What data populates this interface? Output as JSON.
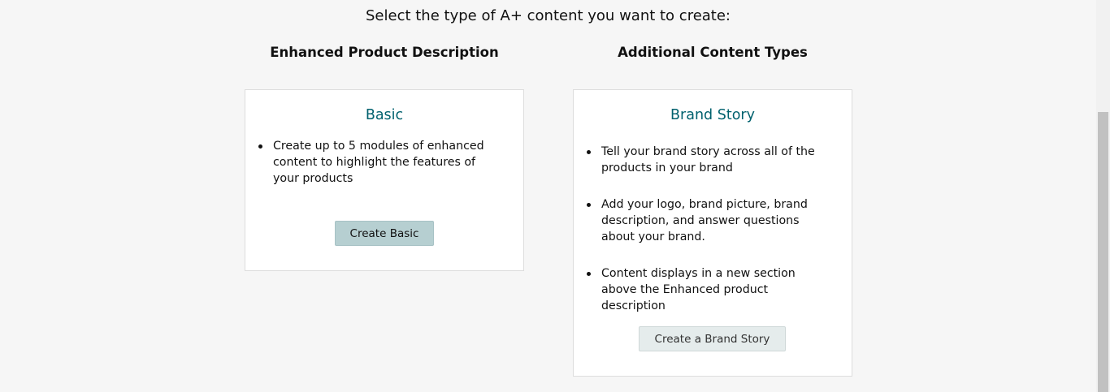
{
  "page": {
    "heading": "Select the type of A+ content you want to create:"
  },
  "columns": {
    "left_title": "Enhanced Product Description",
    "right_title": "Additional Content Types"
  },
  "basic_card": {
    "title": "Basic",
    "bullets": [
      "Create up to 5 modules of enhanced content to highlight the features of your products"
    ],
    "button_label": "Create Basic"
  },
  "brand_card": {
    "title": "Brand Story",
    "bullets": [
      "Tell your brand story across all of the products in your brand",
      "Add your logo, brand picture, brand description, and answer questions about your brand.",
      "Content displays in a new section above the Enhanced product description"
    ],
    "button_label": "Create a Brand Story"
  },
  "colors": {
    "card_title": "#00616e",
    "basic_button_bg": "#b6cfd1",
    "brand_button_bg": "#e5ecec",
    "page_bg": "#f6f6f6"
  }
}
